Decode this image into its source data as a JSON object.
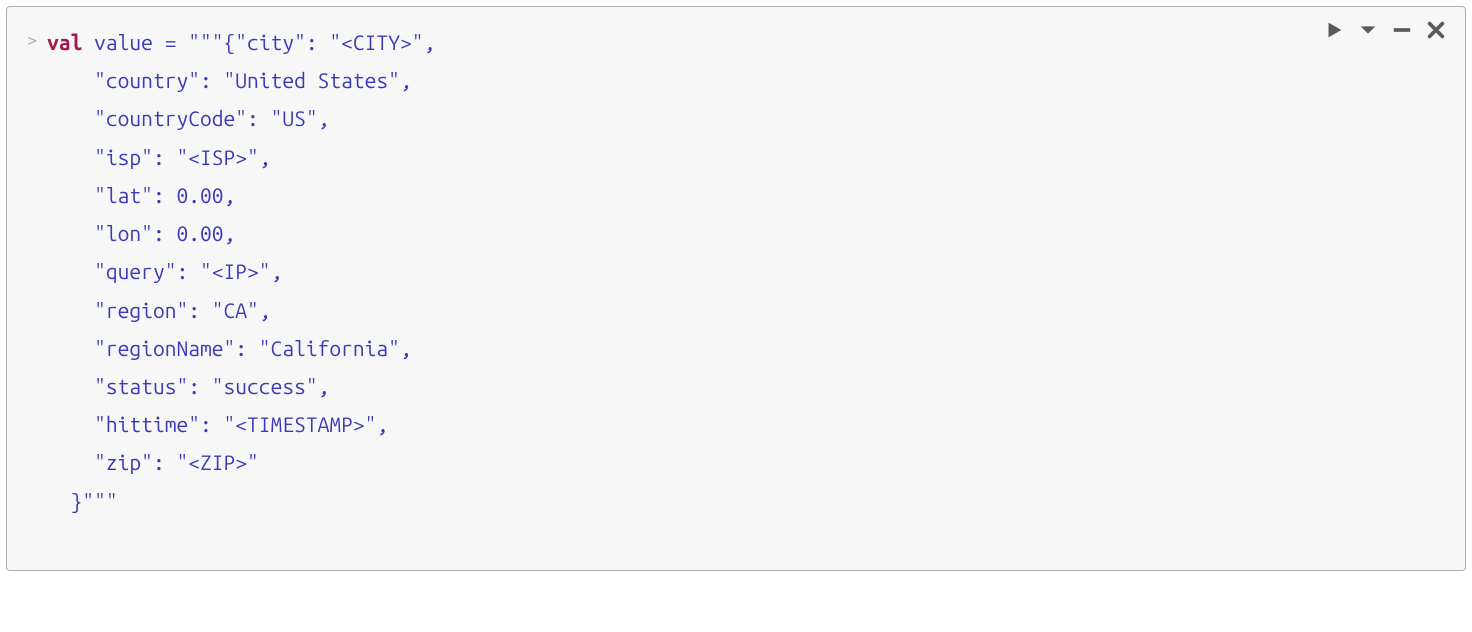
{
  "gutter": {
    "prompt": ">"
  },
  "code": {
    "keyword": "val",
    "ident": "value",
    "eq": "=",
    "q_open": "\"\"\"",
    "q_close": "\"\"\"",
    "brace_open": "{",
    "brace_close": "}",
    "comma": ",",
    "colon": ":",
    "k_city": "\"city\"",
    "v_city": "\"<CITY>\"",
    "k_country": "\"country\"",
    "v_country": "\"United States\"",
    "k_countryCode": "\"countryCode\"",
    "v_countryCode": "\"US\"",
    "k_isp": "\"isp\"",
    "v_isp": "\"<ISP>\"",
    "k_lat": "\"lat\"",
    "v_lat": "0.00",
    "k_lon": "\"lon\"",
    "v_lon": "0.00",
    "k_query": "\"query\"",
    "v_query": "\"<IP>\"",
    "k_region": "\"region\"",
    "v_region": "\"CA\"",
    "k_regionName": "\"regionName\"",
    "v_regionName": "\"California\"",
    "k_status": "\"status\"",
    "v_status": "\"success\"",
    "k_hittime": "\"hittime\"",
    "v_hittime": "\"<TIMESTAMP>\"",
    "k_zip": "\"zip\"",
    "v_zip": "\"<ZIP>\""
  }
}
